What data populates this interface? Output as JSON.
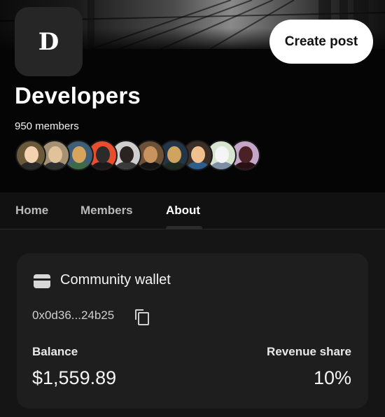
{
  "community": {
    "name": "Developers",
    "logo_letter": "D",
    "members_text": "950 members",
    "create_post_label": "Create post"
  },
  "member_avatars": [
    {
      "icon": "member-avatar",
      "bg": "#6b5a3a",
      "face": "#f2d2b0",
      "shirt": "#2a2a2a"
    },
    {
      "icon": "member-avatar",
      "bg": "#a59173",
      "face": "#e0c29b",
      "shirt": "#2f2f2f"
    },
    {
      "icon": "member-avatar",
      "bg": "#3f5e77",
      "face": "#d7a35d",
      "shirt": "#3c6a45"
    },
    {
      "icon": "member-avatar",
      "bg": "#e84d2e",
      "face": "#2b2b2b",
      "shirt": "#1a1a1a"
    },
    {
      "icon": "member-avatar",
      "bg": "#cfcfcf",
      "face": "#2a2322",
      "shirt": "#3a3a3a"
    },
    {
      "icon": "member-avatar",
      "bg": "#6c5137",
      "face": "#c9935f",
      "shirt": "#141414"
    },
    {
      "icon": "member-avatar",
      "bg": "#243549",
      "face": "#d0a45e",
      "shirt": "#1c2a1f"
    },
    {
      "icon": "member-avatar",
      "bg": "#3c2f27",
      "face": "#f0c08f",
      "shirt": "#2b5e8a"
    },
    {
      "icon": "member-avatar",
      "bg": "#d8e6cf",
      "face": "#f5f5f5",
      "shirt": "#7c8fa3"
    },
    {
      "icon": "member-avatar",
      "bg": "#c4a6c8",
      "face": "#4a2124",
      "shirt": "#2a1012"
    }
  ],
  "tabs": [
    {
      "label": "Home",
      "active": false
    },
    {
      "label": "Members",
      "active": false
    },
    {
      "label": "About",
      "active": true
    }
  ],
  "wallet": {
    "title": "Community wallet",
    "address": "0x0d36...24b25",
    "balance_label": "Balance",
    "balance_value": "$1,559.89",
    "revenue_label": "Revenue share",
    "revenue_value": "10%"
  }
}
